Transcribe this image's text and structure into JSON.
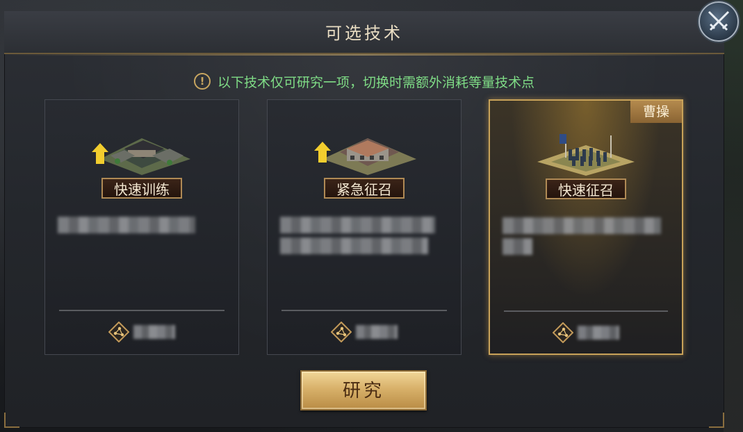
{
  "dialog": {
    "title": "可选技术",
    "notice": "以下技术仅可研究一项，切换时需额外消耗等量技术点",
    "warning_icon_glyph": "!"
  },
  "cards": [
    {
      "name": "快速训练",
      "building": "barracks-icon",
      "tag": null,
      "selected": false
    },
    {
      "name": "紧急征召",
      "building": "fortress-icon",
      "tag": null,
      "selected": false
    },
    {
      "name": "快速征召",
      "building": "troops-icon",
      "tag": "曹操",
      "selected": true
    }
  ],
  "research_button": "研究",
  "colors": {
    "notice_green": "#7fdc86",
    "gold": "#c8a259",
    "text_light": "#e8dcc2"
  }
}
